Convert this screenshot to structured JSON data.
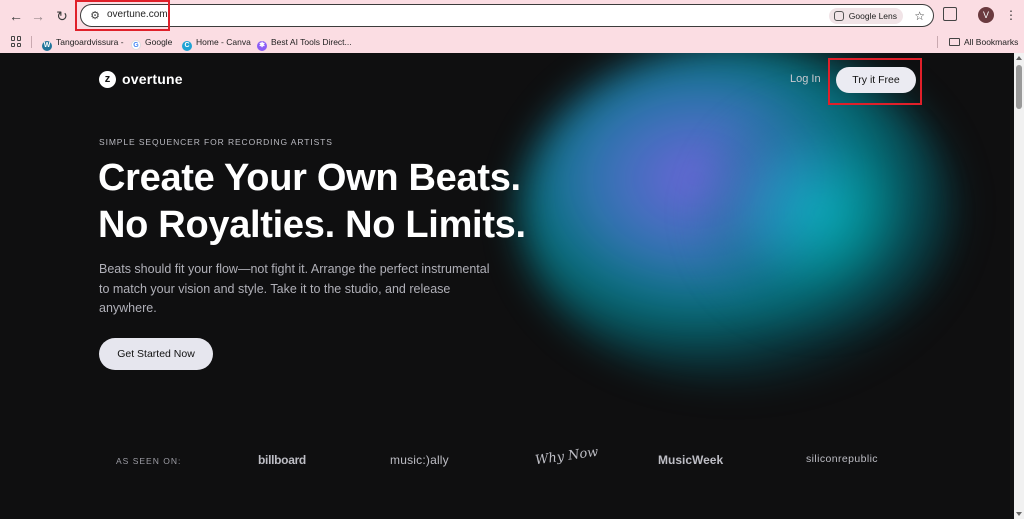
{
  "browser": {
    "url": "overtune.com",
    "lens_label": "Google Lens",
    "profile_initial": "V",
    "bookmarks": [
      {
        "label": "Tangoardvissura -",
        "icon": "wordpress-icon"
      },
      {
        "label": "Google",
        "icon": "google-icon"
      },
      {
        "label": "Home - Canva",
        "icon": "canva-icon"
      },
      {
        "label": "Best AI Tools Direct...",
        "icon": "gear-icon"
      }
    ],
    "all_bookmarks_label": "All Bookmarks"
  },
  "site": {
    "logo_text": "overtune",
    "nav": {
      "login_label": "Log In",
      "try_label": "Try it Free"
    },
    "hero": {
      "eyebrow": "SIMPLE SEQUENCER FOR RECORDING ARTISTS",
      "headline_line1": "Create Your Own Beats.",
      "headline_line2": "No Royalties. No Limits.",
      "subtext": "Beats should fit your flow—not fight it. Arrange the perfect instrumental to match your vision and style. Take it to the studio, and release anywhere.",
      "cta_label": "Get Started Now"
    },
    "press": {
      "label": "AS SEEN ON:",
      "logos": [
        "billboard",
        "music:)ally",
        "Why Now",
        "MusicWeek",
        "siliconrepublic"
      ]
    }
  },
  "colors": {
    "chrome_bg": "#fbdde3",
    "page_bg": "#0f0f10",
    "highlight": "#e0202a"
  }
}
